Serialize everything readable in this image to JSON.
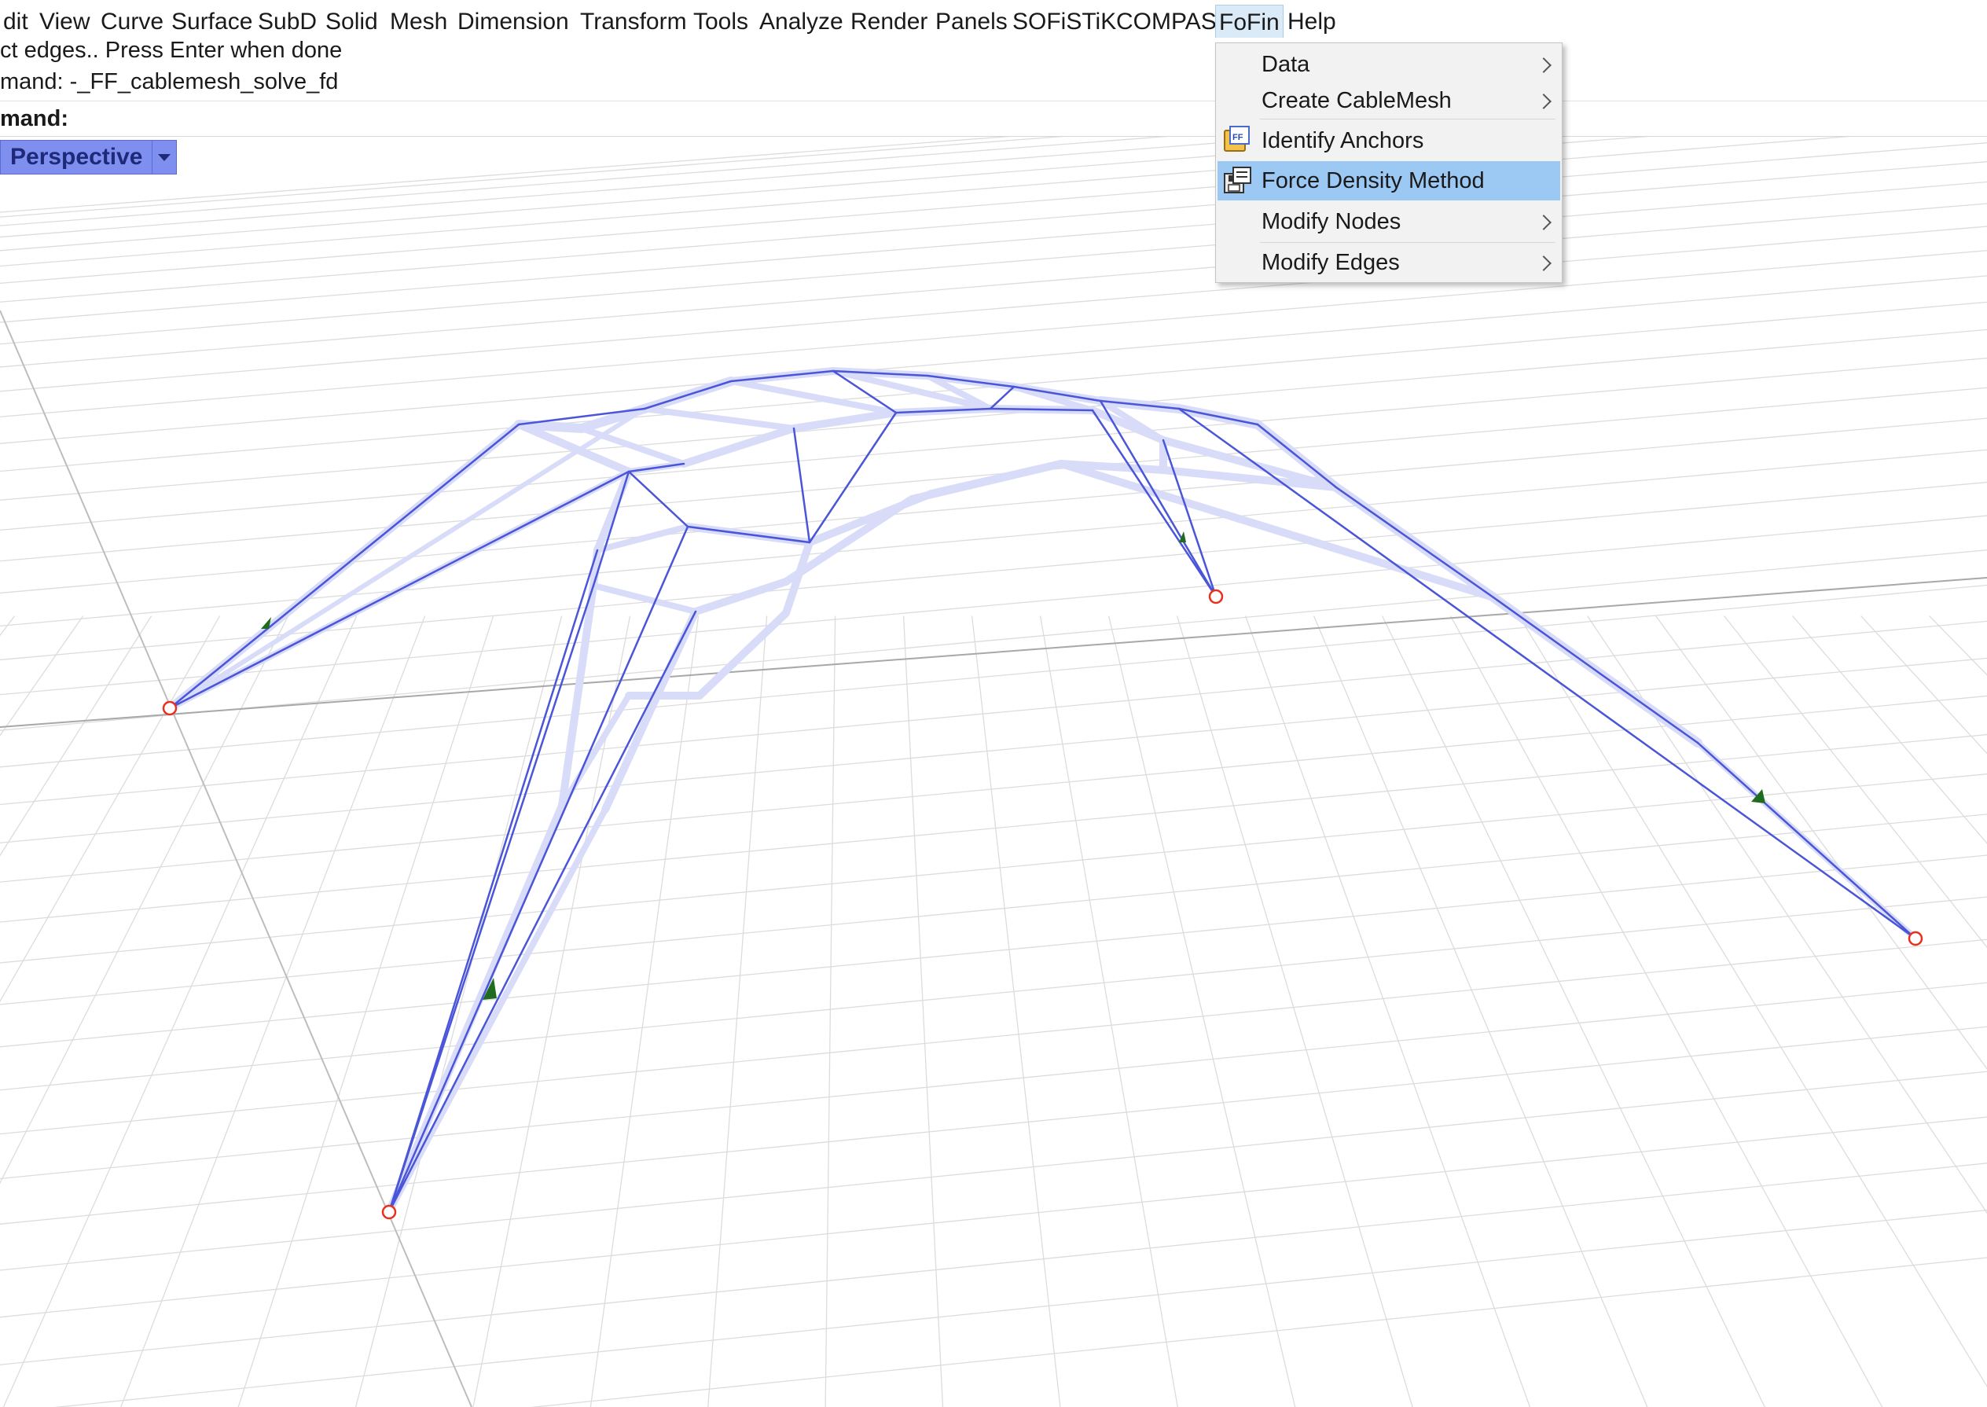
{
  "menubar": {
    "items": [
      "dit",
      "View",
      "Curve",
      "Surface",
      "SubD",
      "Solid",
      "Mesh",
      "Dimension",
      "Transform",
      "Tools",
      "Analyze",
      "Render",
      "Panels",
      "SOFiSTiK",
      "COMPAS",
      "FoFin",
      "Help"
    ],
    "active": "FoFin"
  },
  "command": {
    "history": [
      "ct edges.. Press Enter when done",
      "mand: -_FF_cablemesh_solve_fd"
    ],
    "prompt": "mand:",
    "input_value": ""
  },
  "viewport": {
    "label": "Perspective"
  },
  "fofin_menu": {
    "items": [
      {
        "label": "Data",
        "has_submenu": true,
        "icon": ""
      },
      {
        "label": "Create CableMesh",
        "has_submenu": true,
        "icon": ""
      },
      {
        "label": "Identify Anchors",
        "has_submenu": false,
        "icon": "identify-anchors-icon"
      },
      {
        "label": "Force Density Method",
        "has_submenu": false,
        "icon": "force-density-icon",
        "highlighted": true
      },
      {
        "label": "Modify Nodes",
        "has_submenu": true,
        "icon": ""
      },
      {
        "label": "Modify Edges",
        "has_submenu": true,
        "icon": ""
      }
    ]
  },
  "colors": {
    "cable_strong": "#4a55d8",
    "cable_light": "#d8dcf8",
    "anchor": "#e8301e",
    "load_arrow": "#1f6b1f",
    "grid": "#dcdcdc",
    "menu_highlight": "#9cc8f4",
    "viewport_tab": "#7f8ff0"
  }
}
